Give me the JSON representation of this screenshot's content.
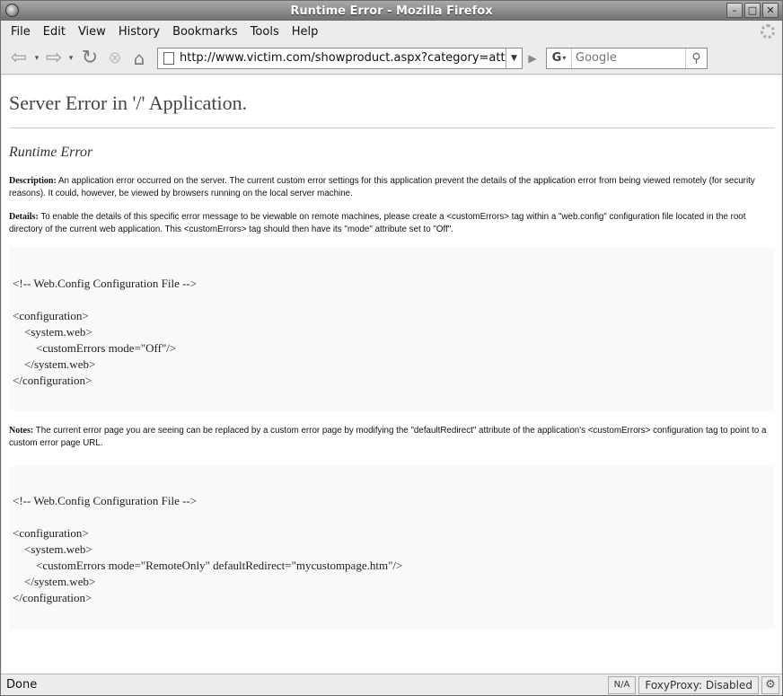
{
  "window": {
    "title": "Runtime Error - Mozilla Firefox"
  },
  "menu": {
    "items": [
      "File",
      "Edit",
      "View",
      "History",
      "Bookmarks",
      "Tools",
      "Help"
    ]
  },
  "nav": {
    "url": "http://www.victim.com/showproduct.aspx?category=attacker'",
    "search_placeholder": "Google",
    "search_engine": "G"
  },
  "page": {
    "title": "Server Error in '/' Application.",
    "subtitle": "Runtime Error",
    "description_label": "Description:",
    "description_text": " An application error occurred on the server. The current custom error settings for this application prevent the details of the application error from being viewed remotely (for security reasons). It could, however, be viewed by browsers running on the local server machine.",
    "details_label": "Details:",
    "details_text": " To enable the details of this specific error message to be viewable on remote machines, please create a <customErrors> tag within a \"web.config\" configuration file located in the root directory of the current web application. This <customErrors> tag should then have its \"mode\" attribute set to \"Off\".",
    "code1": {
      "comment": "<!-- Web.Config Configuration File -->",
      "l1": "<configuration>",
      "l2": "    <system.web>",
      "l3": "        <customErrors mode=\"Off\"/>",
      "l4": "    </system.web>",
      "l5": "</configuration>"
    },
    "notes_label": "Notes:",
    "notes_text": " The current error page you are seeing can be replaced by a custom error page by modifying the \"defaultRedirect\" attribute of the application's <customErrors> configuration tag to point to a custom error page URL.",
    "code2": {
      "comment": "<!-- Web.Config Configuration File -->",
      "l1": "<configuration>",
      "l2": "    <system.web>",
      "l3": "        <customErrors mode=\"RemoteOnly\" defaultRedirect=\"mycustompage.htm\"/>",
      "l4": "    </system.web>",
      "l5": "</configuration>"
    }
  },
  "status": {
    "text": "Done",
    "na": "N/A",
    "foxyproxy": "FoxyProxy: Disabled"
  }
}
